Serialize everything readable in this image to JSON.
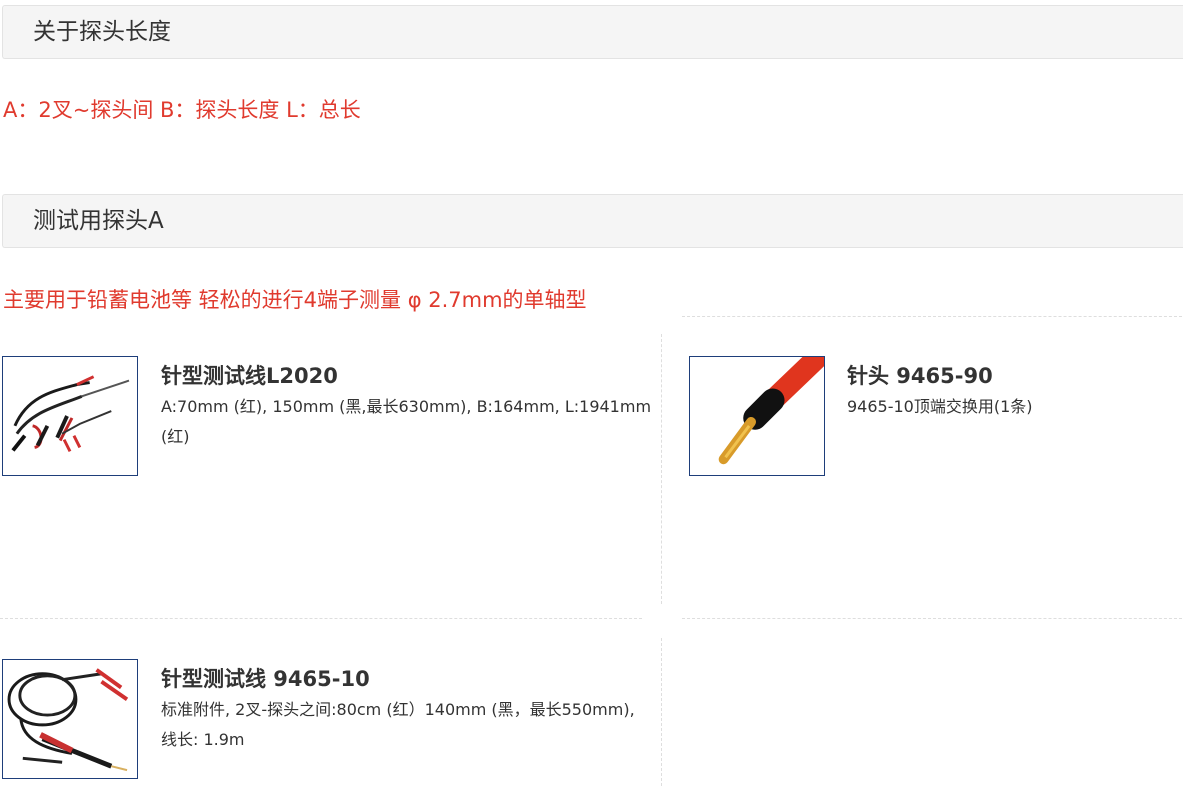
{
  "sections": {
    "probe_length": {
      "title": "关于探头长度"
    },
    "test_probe_a": {
      "title": "测试用探头A"
    }
  },
  "spec_legend": "A：2叉~探头间 B：探头长度 L：总长",
  "description": "主要用于铅蓄电池等 轻松的进行4端子测量 φ 2.7mm的单轴型",
  "products": [
    {
      "title": "针型测试线L2020",
      "desc_line1": "A:70mm (红), 150mm (黑,最长630mm), B:164mm, L:1941mm",
      "desc_line2": "(红)",
      "image_icon": "probe-lead-set-image"
    },
    {
      "title": "针头 9465-90",
      "desc_line1": "9465-10顶端交换用(1条)",
      "desc_line2": "",
      "image_icon": "pin-tip-image"
    },
    {
      "title": "针型测试线 9465-10",
      "desc_line1": "标准附件, 2叉-探头之间:80cm (红）140mm (黑，最长550mm),",
      "desc_line2": "线长: 1.9m",
      "image_icon": "coiled-lead-image"
    }
  ],
  "colors": {
    "accent_red": "#e03a2e",
    "header_bg": "#f5f5f5",
    "thumb_border": "#1e3e7a"
  }
}
